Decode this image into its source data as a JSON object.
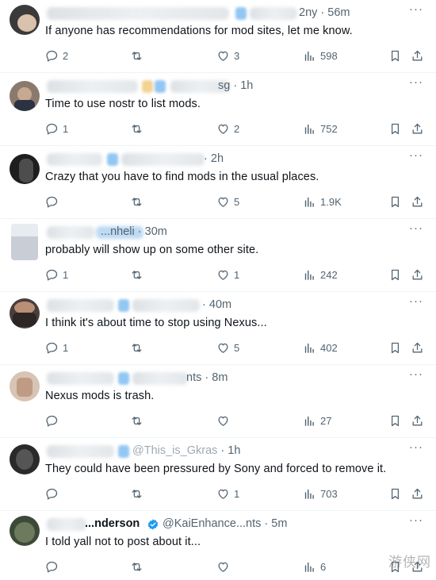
{
  "tweets": [
    {
      "handle_tail": "2ny",
      "time": "56m",
      "text": "If anyone has recommendations for mod sites, let me know.",
      "replies": "2",
      "retweets": "",
      "likes": "3",
      "views": "598",
      "avatar_color": "#3a3a3a"
    },
    {
      "handle_tail": "sg",
      "time": "1h",
      "text": "Time to use nostr to list mods.",
      "replies": "1",
      "retweets": "",
      "likes": "2",
      "views": "752",
      "avatar_color": "#8a7a6e"
    },
    {
      "handle_tail": "",
      "time": "2h",
      "text": "Crazy that you have to find mods in the usual places.",
      "replies": "",
      "retweets": "",
      "likes": "5",
      "views": "1.9K",
      "avatar_color": "#1e1e1e"
    },
    {
      "handle_tail": "...nheli",
      "time": "30m",
      "text": "probably will show up on some other site.",
      "replies": "1",
      "retweets": "",
      "likes": "1",
      "views": "242",
      "avatar_color": "#c9ced6"
    },
    {
      "handle_tail": "",
      "time": "40m",
      "text": "I think it's about time to stop using Nexus...",
      "replies": "1",
      "retweets": "",
      "likes": "5",
      "views": "402",
      "avatar_color": "#4a3f3a"
    },
    {
      "handle_tail": "nts",
      "time": "8m",
      "text": "Nexus mods is trash.",
      "replies": "",
      "retweets": "",
      "likes": "",
      "views": "27",
      "avatar_color": "#d8c4b4"
    },
    {
      "handle_tail": "@This_is_Gkras",
      "time": "1h",
      "text": "They could have been pressured by Sony and forced to remove it.",
      "replies": "",
      "retweets": "",
      "likes": "1",
      "views": "703",
      "avatar_color": "#2a2a2a"
    },
    {
      "handle_tail": "...nderson",
      "handle_tail2": "@KaiEnhance...nts",
      "time": "5m",
      "text": "I told yall not to post about it...",
      "replies": "",
      "retweets": "",
      "likes": "",
      "views": "6",
      "avatar_color": "#3c4a38"
    }
  ],
  "separator": "·",
  "more_glyph": "···",
  "watermark": "游侠网",
  "colors": {
    "text": "#0f1419",
    "secondary": "#536471",
    "divider": "#eff3f4",
    "verified": "#1d9bf0"
  },
  "icons": {
    "reply": "reply-icon",
    "retweet": "retweet-icon",
    "like": "heart-icon",
    "views": "views-icon",
    "bookmark": "bookmark-icon",
    "share": "share-icon",
    "more": "more-icon"
  }
}
